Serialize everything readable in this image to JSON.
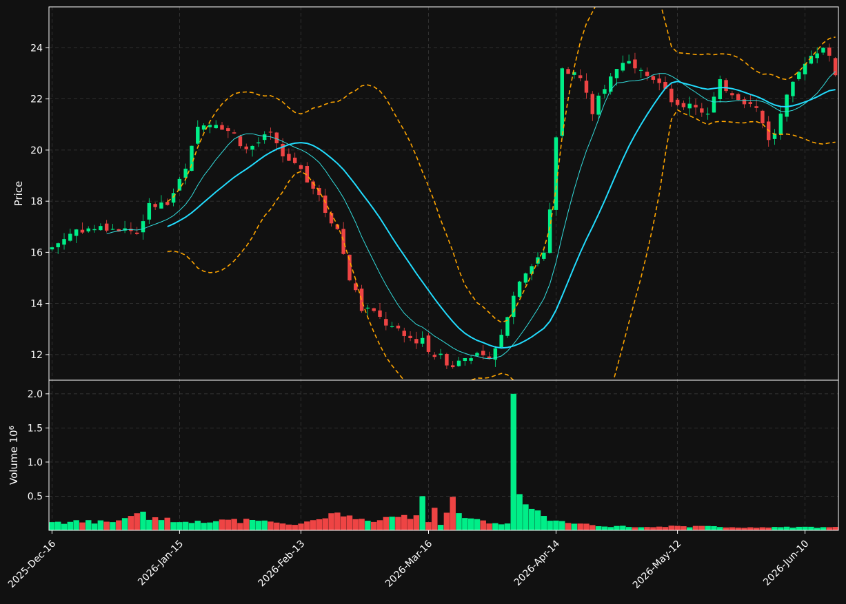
{
  "chart_data": {
    "type": "candlestick",
    "style": {
      "background": "#111111",
      "up_color": "#00ee88",
      "down_color": "#ee4444",
      "grid_color": "#3a3a3a",
      "ma_fast_color": "#33dddd",
      "ma_slow_color": "#22ddff",
      "band_color": "#ffa500",
      "axis_color": "#ffffff",
      "grid": true
    },
    "x_tick_labels": [
      "2025-Dec-16",
      "2026-Jan-15",
      "2026-Feb-13",
      "2026-Mar-16",
      "2026-Apr-14",
      "2026-May-12",
      "2026-Jun-10"
    ],
    "x_tick_indices": [
      0,
      21,
      41,
      62,
      83,
      103,
      124
    ],
    "n_bars": 130,
    "price_panel": {
      "ylabel": "Price",
      "ylim": [
        11.0,
        25.6
      ],
      "yticks": [
        12,
        14,
        16,
        18,
        20,
        22,
        24
      ]
    },
    "volume_panel": {
      "ylabel": "Volume",
      "ylabel_exp": "10",
      "ylabel_sup": "6",
      "ylim": [
        0,
        2.2
      ],
      "yticks": [
        "0.5",
        "1.0",
        "1.5",
        "2.0"
      ],
      "ytick_values": [
        0.5,
        1.0,
        1.5,
        2.0
      ]
    },
    "close_anchors": [
      [
        0,
        16.2
      ],
      [
        4,
        16.9
      ],
      [
        10,
        16.95
      ],
      [
        14,
        16.8
      ],
      [
        16,
        17.8
      ],
      [
        19,
        17.9
      ],
      [
        22,
        19.2
      ],
      [
        24,
        20.9
      ],
      [
        27,
        21.1
      ],
      [
        30,
        20.6
      ],
      [
        32,
        20.0
      ],
      [
        34,
        20.3
      ],
      [
        36,
        20.6
      ],
      [
        38,
        19.7
      ],
      [
        40,
        19.5
      ],
      [
        43,
        18.6
      ],
      [
        45,
        17.6
      ],
      [
        47,
        16.9
      ],
      [
        49,
        15.0
      ],
      [
        51,
        13.8
      ],
      [
        53,
        13.6
      ],
      [
        55,
        13.2
      ],
      [
        58,
        12.7
      ],
      [
        61,
        12.5
      ],
      [
        63,
        12.0
      ],
      [
        66,
        11.6
      ],
      [
        69,
        12.0
      ],
      [
        71,
        11.8
      ],
      [
        73,
        12.2
      ],
      [
        75,
        13.6
      ],
      [
        77,
        15.0
      ],
      [
        79,
        15.6
      ],
      [
        81,
        16.0
      ],
      [
        82,
        17.7
      ],
      [
        84,
        23.3
      ],
      [
        87,
        22.8
      ],
      [
        89,
        21.5
      ],
      [
        91,
        22.5
      ],
      [
        94,
        23.5
      ],
      [
        97,
        23.3
      ],
      [
        100,
        22.6
      ],
      [
        103,
        21.6
      ],
      [
        105,
        21.9
      ],
      [
        108,
        21.4
      ],
      [
        110,
        22.6
      ],
      [
        113,
        22.1
      ],
      [
        116,
        21.6
      ],
      [
        118,
        20.5
      ],
      [
        119,
        20.7
      ],
      [
        121,
        22.0
      ],
      [
        124,
        23.5
      ],
      [
        127,
        24.1
      ],
      [
        129,
        23.0
      ]
    ],
    "volume_anchors": [
      [
        0,
        0.12
      ],
      [
        10,
        0.12
      ],
      [
        14,
        0.25
      ],
      [
        18,
        0.15
      ],
      [
        24,
        0.14
      ],
      [
        34,
        0.14
      ],
      [
        40,
        0.08
      ],
      [
        46,
        0.25
      ],
      [
        52,
        0.14
      ],
      [
        60,
        0.22
      ],
      [
        61,
        0.5
      ],
      [
        62,
        0.12
      ],
      [
        63,
        0.33
      ],
      [
        64,
        0.08
      ],
      [
        66,
        0.49
      ],
      [
        68,
        0.18
      ],
      [
        72,
        0.1
      ],
      [
        75,
        0.1
      ],
      [
        76,
        2.0
      ],
      [
        77,
        0.53
      ],
      [
        78,
        0.38
      ],
      [
        82,
        0.14
      ],
      [
        90,
        0.06
      ],
      [
        104,
        0.06
      ],
      [
        118,
        0.04
      ],
      [
        129,
        0.05
      ]
    ],
    "ma_fast_period": 10,
    "ma_slow_period": 20
  }
}
